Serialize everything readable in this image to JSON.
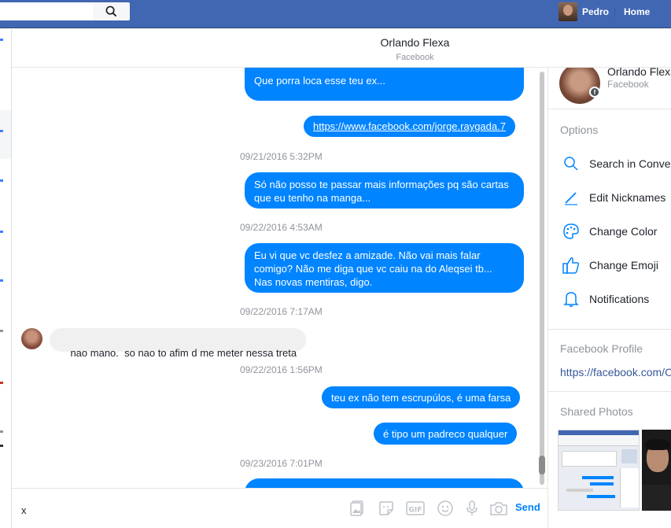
{
  "topbar": {
    "user_name": "Pedro",
    "home_label": "Home"
  },
  "conversation": {
    "title": "Orlando Flexa",
    "subtitle": "Facebook"
  },
  "messages": {
    "m1": "Que porra loca esse teu ex...",
    "m2": "https://www.facebook.com/jorge.raygada.7",
    "t1": "09/21/2016 5:32PM",
    "m3_l1": "Só não posso te passar mais informações pq são cartas",
    "m3_l2": "que eu tenho na manga...",
    "t2": "09/22/2016 4:53AM",
    "m4_l1": "Eu vi que vc desfez a amizade. Não vai mais falar",
    "m4_l2": "comigo? Não me diga que vc caiu na do Aleqsei tb...",
    "m4_l3": "Nas novas mentiras, digo.",
    "t3": "09/22/2016 7:17AM",
    "m5": "nao mano.  so nao to afim d me meter nessa treta",
    "t4": "09/22/2016 1:56PM",
    "m6": "teu ex não tem escrupúlos, é uma farsa",
    "m7": "é tipo um padreco qualquer",
    "t5": "09/23/2016 7:01PM"
  },
  "composer": {
    "value": "x",
    "send_label": "Send"
  },
  "sidebar": {
    "name": "Orlando Flexa",
    "network": "Facebook",
    "options_header": "Options",
    "options": [
      {
        "label": "Search in Convers",
        "icon": "search-icon"
      },
      {
        "label": "Edit Nicknames",
        "icon": "pencil-icon"
      },
      {
        "label": "Change Color",
        "icon": "palette-icon"
      },
      {
        "label": "Change Emoji",
        "icon": "thumbs-up-icon"
      },
      {
        "label": "Notifications",
        "icon": "bell-icon"
      }
    ],
    "profile_header": "Facebook Profile",
    "profile_link": "https://facebook.com/O",
    "photos_header": "Shared Photos"
  },
  "colors": {
    "brand": "#4267b2",
    "bubble": "#0084ff",
    "link": "#365899"
  }
}
